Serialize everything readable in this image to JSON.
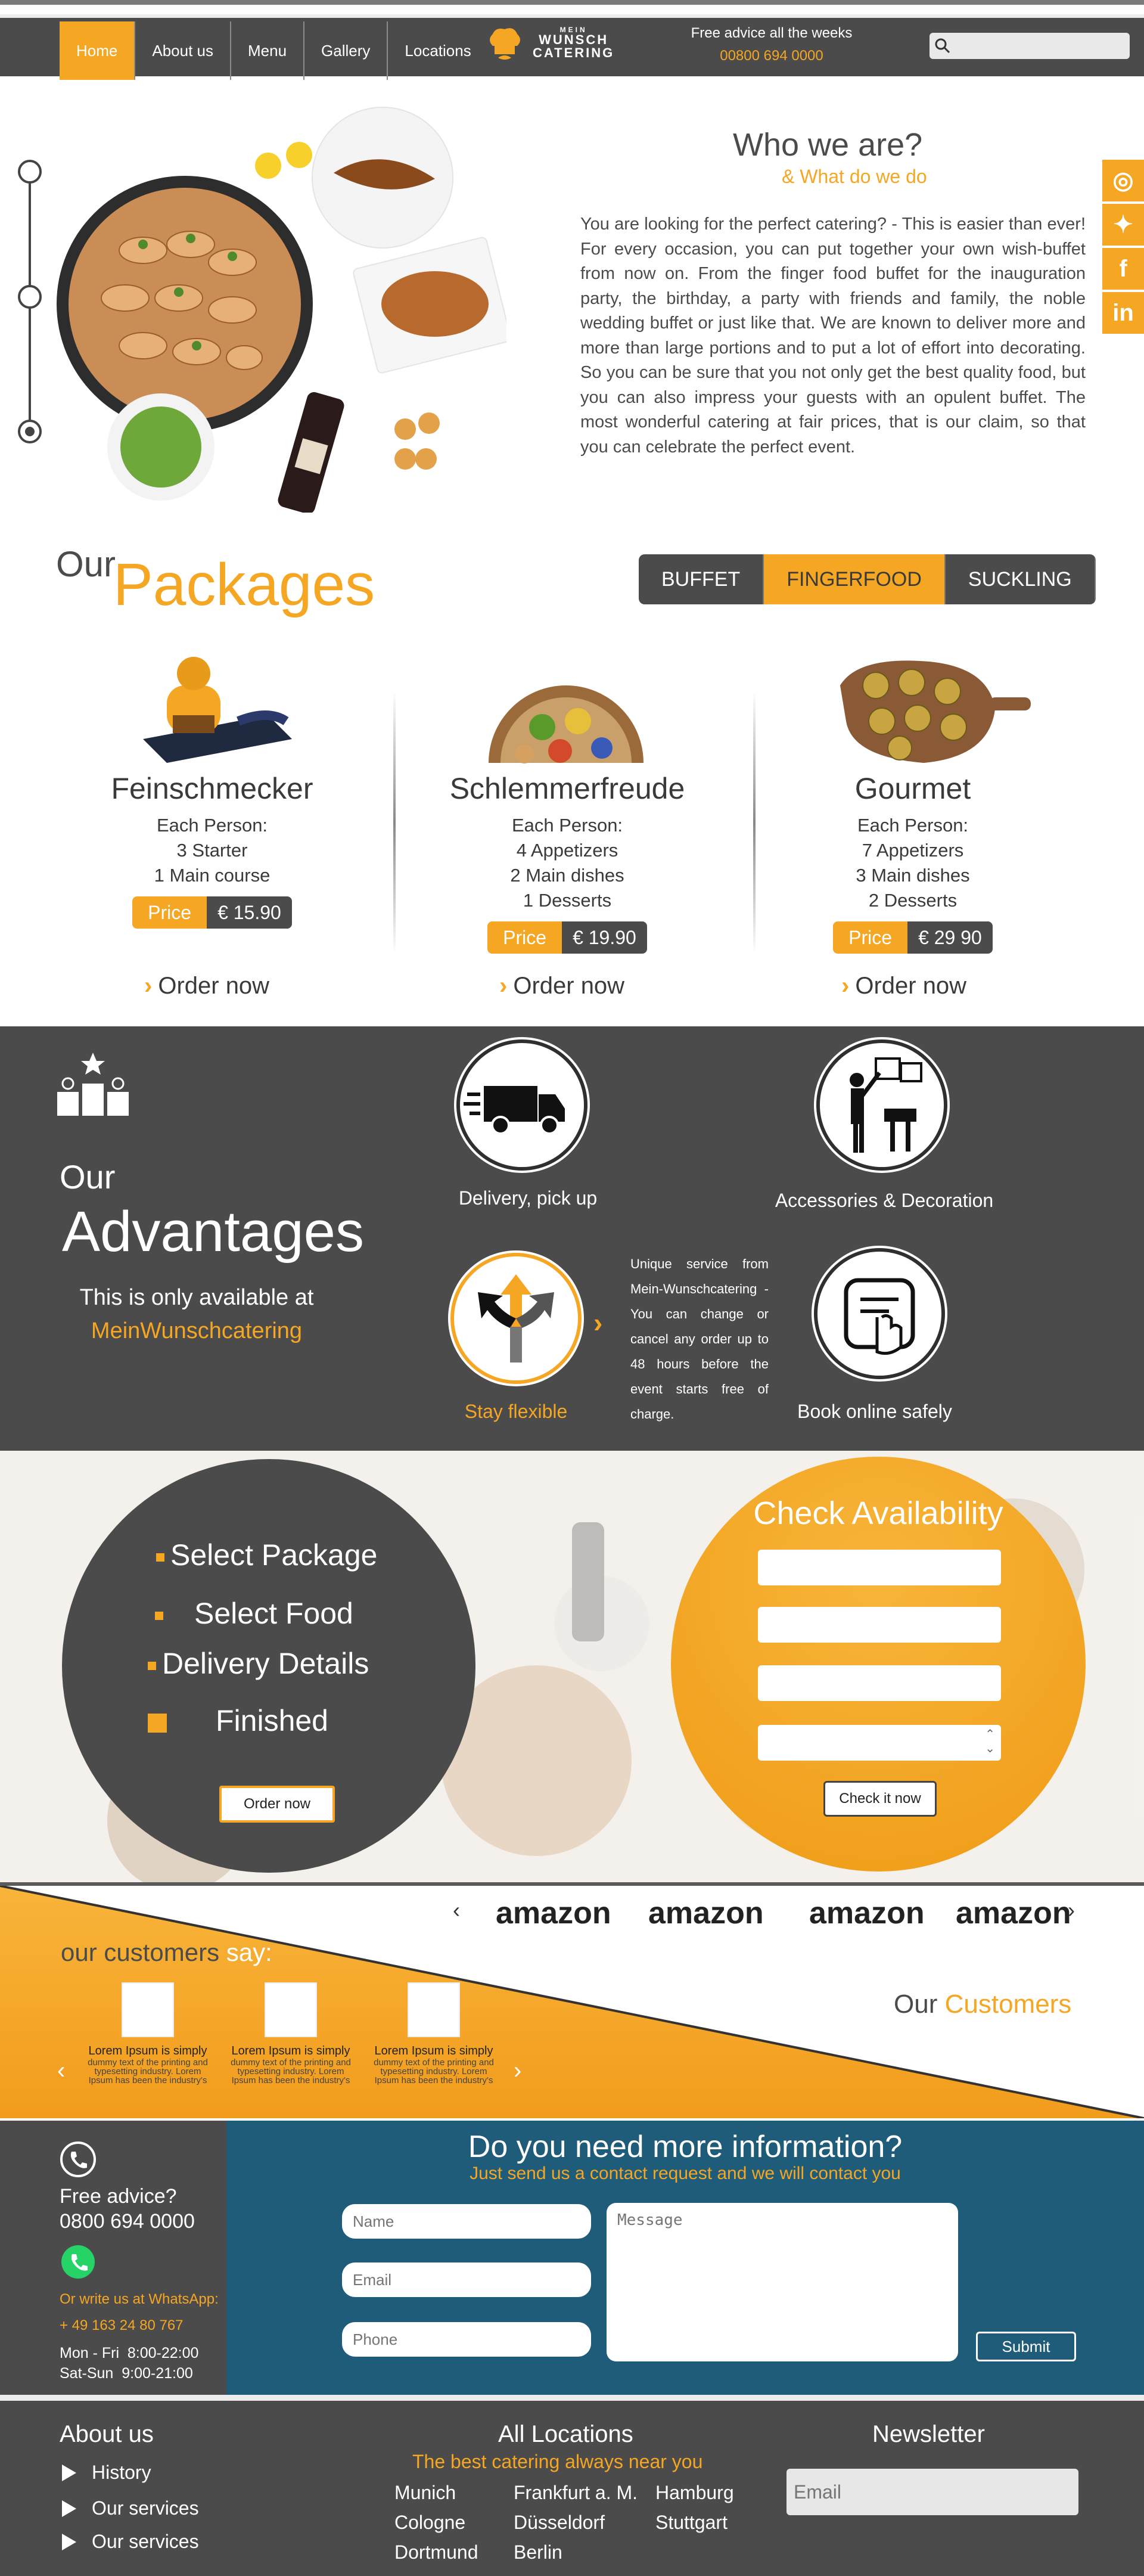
{
  "header": {
    "nav": [
      "Home",
      "About us",
      "Menu",
      "Gallery",
      "Locations"
    ],
    "logo": {
      "top": "MEIN",
      "mid": "WUNSCH",
      "bottom": "CATERING"
    },
    "advice_title": "Free advice all the weeks",
    "advice_phone": "00800 694 0000",
    "search_placeholder": ""
  },
  "about": {
    "title": "Who we are?",
    "subtitle": "& What do we do",
    "text": "You are looking for the perfect catering? - This is easier than ever! For every occasion, you can put together your own wish-buffet from now on. From the finger food buffet for the inauguration party, the birthday, a party with friends and family, the noble wedding buffet or just like that. We are known to deliver more and more than large portions and to put a lot of effort into decorating. So you can be sure that you not only get the best quality food, but you can also impress your guests with an opulent buffet. The most wonderful catering at fair prices, that is our claim, so that you can celebrate the perfect event."
  },
  "packages": {
    "heading_small": "Our",
    "heading_big": "Packages",
    "tabs": [
      "BUFFET",
      "FINGERFOOD",
      "SUCKLING"
    ],
    "active_tab": "FINGERFOOD",
    "items": [
      {
        "name": "Feinschmecker",
        "lines": [
          "Each Person:",
          "3 Starter",
          "1 Main course"
        ],
        "price_label": "Price",
        "price": "€ 15.90",
        "order": "Order now"
      },
      {
        "name": "Schlemmerfreude",
        "lines": [
          "Each Person:",
          "4 Appetizers",
          "2 Main dishes",
          "1 Desserts"
        ],
        "price_label": "Price",
        "price": "€ 19.90",
        "order": "Order now"
      },
      {
        "name": "Gourmet",
        "lines": [
          "Each Person:",
          "7 Appetizers",
          "3 Main dishes",
          "2 Desserts"
        ],
        "price_label": "Price",
        "price": "€ 29 90",
        "order": "Order now"
      }
    ]
  },
  "advantages": {
    "our": "Our",
    "title": "Advantages",
    "only": "This is only available at",
    "brand": "MeinWunschcatering",
    "items": {
      "delivery": "Delivery, pick up",
      "accessories": "Accessories & Decoration",
      "flexible": "Stay flexible",
      "booking": "Book online safely"
    },
    "flex_text": "Unique service from Mein-Wunschcatering -You can change or cancel any order up to 48 hours before the event starts free of charge."
  },
  "steps": {
    "items": [
      "Select Package",
      "Select Food",
      "Delivery Details",
      "Finished"
    ],
    "order_button": "Order now",
    "availability_title": "Check Availability",
    "check_button": "Check it now"
  },
  "customers": {
    "brands": [
      "amazon",
      "amazon",
      "amazon",
      "amazon"
    ],
    "say_a": "our customers",
    "say_b": "say:",
    "right_a": "Our",
    "right_b": "Customers",
    "testimonials": [
      {
        "title": "Lorem Ipsum is simply",
        "body": "dummy text of the printing and typesetting industry. Lorem Ipsum has been the industry's"
      },
      {
        "title": "Lorem Ipsum is simply",
        "body": "dummy text of the printing and typesetting industry. Lorem Ipsum has been the industry's"
      },
      {
        "title": "Lorem Ipsum is simply",
        "body": "dummy text of the printing and typesetting industry. Lorem Ipsum has been the industry's"
      }
    ]
  },
  "contact": {
    "free_advice": "Free advice?",
    "phone": "0800 694 0000",
    "whatsapp_label": "Or write us at WhatsApp:",
    "whatsapp_number": "+ 49 163 24 80 767",
    "hours1": "Mon - Fri  8:00-22:00",
    "hours2": "Sat-Sun  9:00-21:00",
    "title": "Do you need more information?",
    "subtitle": "Just send us a contact request and we will contact you",
    "name_ph": "Name",
    "email_ph": "Email",
    "phone_ph": "Phone",
    "message_ph": "Message",
    "submit": "Submit"
  },
  "footer": {
    "about_title": "About us",
    "links": [
      "History",
      "Our services",
      "Our services"
    ],
    "locations_title": "All Locations",
    "locations_sub": "The best catering always near you",
    "cities": [
      "Munich",
      "Frankfurt a. M.",
      "Hamburg",
      "Cologne",
      "Düsseldorf",
      "Stuttgart",
      "Dortmund",
      "Berlin"
    ],
    "newsletter_title": "Newsletter",
    "newsletter_ph": "Email"
  },
  "colors": {
    "accent": "#f5a623",
    "dark": "#4b4b4b",
    "blue": "#1f5c7a"
  }
}
